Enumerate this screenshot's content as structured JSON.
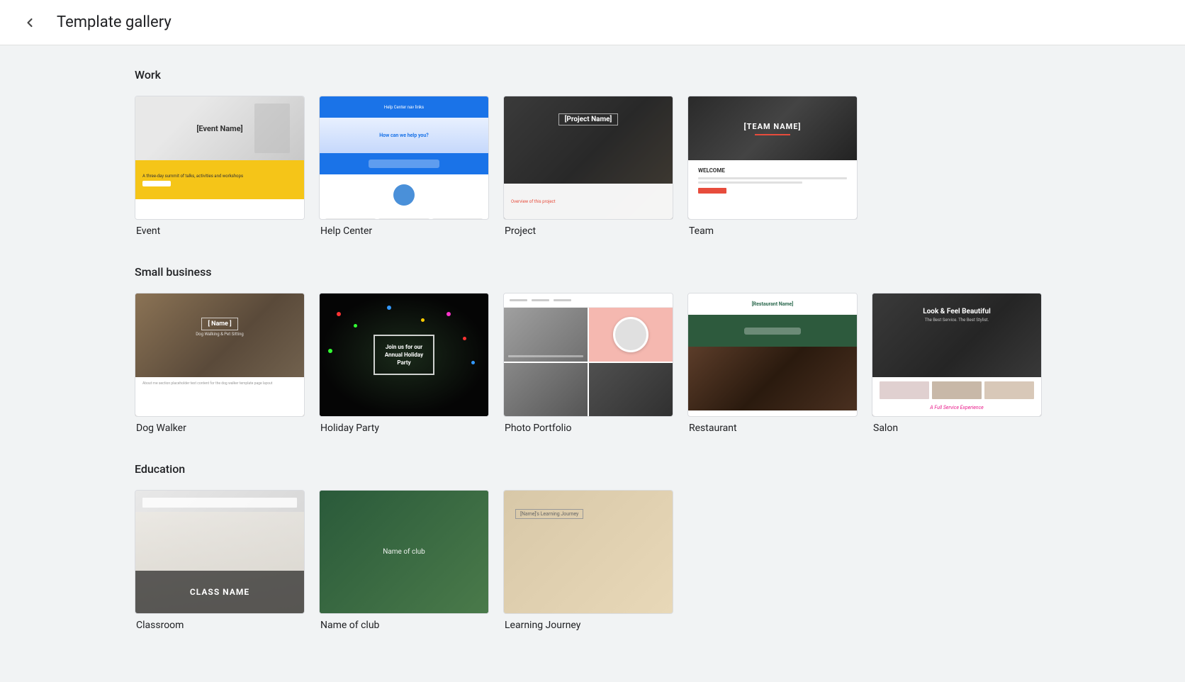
{
  "header": {
    "title": "Template gallery",
    "back_label": "Back"
  },
  "sections": [
    {
      "id": "work",
      "title": "Work",
      "templates": [
        {
          "id": "event",
          "name": "Event",
          "thumb_type": "event"
        },
        {
          "id": "helpcenter",
          "name": "Help Center",
          "thumb_type": "helpcenter"
        },
        {
          "id": "project",
          "name": "Project",
          "thumb_type": "project"
        },
        {
          "id": "team",
          "name": "Team",
          "thumb_type": "team"
        }
      ]
    },
    {
      "id": "small-business",
      "title": "Small business",
      "templates": [
        {
          "id": "dogwalker",
          "name": "Dog Walker",
          "thumb_type": "dogwalker"
        },
        {
          "id": "holidayparty",
          "name": "Holiday Party",
          "thumb_type": "holiday"
        },
        {
          "id": "photoportfolio",
          "name": "Photo Portfolio",
          "thumb_type": "portfolio"
        },
        {
          "id": "restaurant",
          "name": "Restaurant",
          "thumb_type": "restaurant"
        },
        {
          "id": "salon",
          "name": "Salon",
          "thumb_type": "salon"
        }
      ]
    },
    {
      "id": "education",
      "title": "Education",
      "templates": [
        {
          "id": "classroom",
          "name": "Classroom",
          "thumb_type": "class"
        },
        {
          "id": "club",
          "name": "Name of club",
          "thumb_type": "club"
        },
        {
          "id": "learning",
          "name": "Learning Journey",
          "thumb_type": "learning"
        }
      ]
    }
  ],
  "thumbs": {
    "event": {
      "title": "[Event Name]",
      "subtitle": "A three-day summit of talks, activities and workshops"
    },
    "helpcenter": {
      "question": "How can we help you?"
    },
    "project": {
      "title": "[Project Name]",
      "subtitle": "Overview of this project"
    },
    "team": {
      "name": "[TEAM NAME]",
      "welcome": "WELCOME"
    },
    "dogwalker": {
      "name": "[ Name ]",
      "service": "Dog Walking & Pet Sitting"
    },
    "holiday": {
      "line1": "Join us for our",
      "line2": "Annual Holiday",
      "line3": "Party"
    },
    "salon": {
      "title": "Look & Feel Beautiful",
      "subtitle": "The Best Service. The Best Stylist.",
      "tagline": "A Full Service Experience"
    },
    "restaurant": {
      "name": "[Restaurant Name]"
    },
    "class": {
      "name": "CLASS NAME"
    },
    "club": {
      "name": "Name of club"
    },
    "learning": {
      "name": "[Name]'s Learning Journey"
    }
  }
}
